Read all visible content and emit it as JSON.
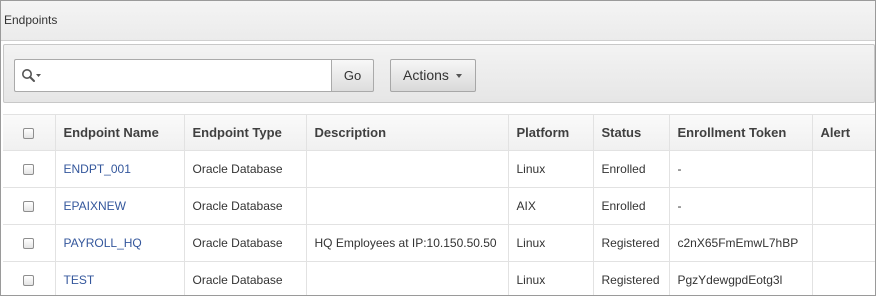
{
  "region": {
    "title": "Endpoints"
  },
  "toolbar": {
    "search_value": "",
    "go_label": "Go",
    "actions_label": "Actions"
  },
  "table": {
    "columns": [
      "Endpoint Name",
      "Endpoint Type",
      "Description",
      "Platform",
      "Status",
      "Enrollment Token",
      "Alert"
    ],
    "rows": [
      {
        "name": "ENDPT_001",
        "type": "Oracle Database",
        "description": "",
        "platform": "Linux",
        "status": "Enrolled",
        "token": "-",
        "alert": ""
      },
      {
        "name": "EPAIXNEW",
        "type": "Oracle Database",
        "description": "",
        "platform": "AIX",
        "status": "Enrolled",
        "token": "-",
        "alert": ""
      },
      {
        "name": "PAYROLL_HQ",
        "type": "Oracle Database",
        "description": "HQ Employees at IP:10.150.50.50",
        "platform": "Linux",
        "status": "Registered",
        "token": "c2nX65FmEmwL7hBP",
        "alert": ""
      },
      {
        "name": "TEST",
        "type": "Oracle Database",
        "description": "",
        "platform": "Linux",
        "status": "Registered",
        "token": "PgzYdewgpdEotg3l",
        "alert": ""
      }
    ]
  },
  "icons": {
    "search": "search-icon",
    "caret": "chevron-down-icon",
    "checkbox": "checkbox"
  },
  "colors": {
    "link": "#34579c",
    "header_bg": "#efefef",
    "border": "#c8c8c8"
  }
}
